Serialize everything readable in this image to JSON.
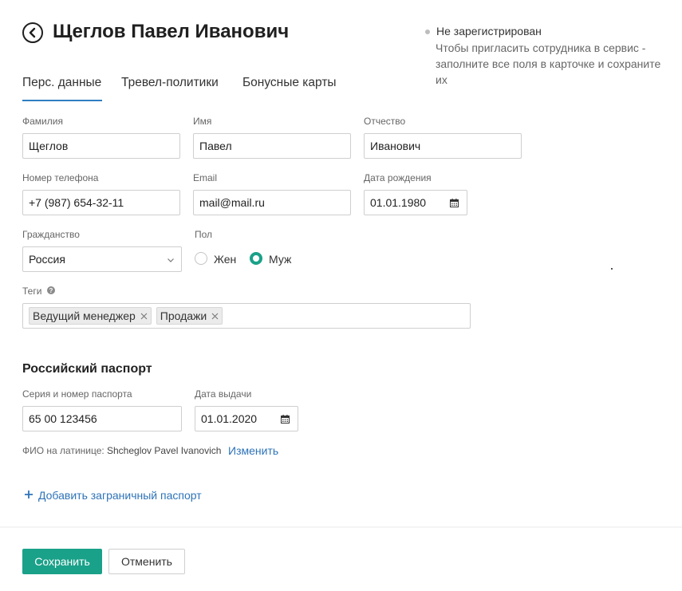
{
  "header": {
    "title": "Щеглов Павел Иванович",
    "status_title": "Не зарегистрирован",
    "status_desc": "Чтобы пригласить сотрудника в сервис - заполните все поля в карточке и сохраните их"
  },
  "tabs": [
    {
      "label": "Перс. данные",
      "active": true
    },
    {
      "label": "Тревел-политики",
      "active": false
    },
    {
      "label": "Бонусные карты",
      "active": false
    }
  ],
  "form": {
    "last_name": {
      "label": "Фамилия",
      "value": "Щеглов"
    },
    "first_name": {
      "label": "Имя",
      "value": "Павел"
    },
    "middle_name": {
      "label": "Отчество",
      "value": "Иванович"
    },
    "phone": {
      "label": "Номер телефона",
      "value": "+7 (987) 654-32-11"
    },
    "email": {
      "label": "Email",
      "value": "mail@mail.ru"
    },
    "birth_date": {
      "label": "Дата рождения",
      "value": "01.01.1980"
    },
    "citizenship": {
      "label": "Гражданство",
      "value": "Россия"
    },
    "gender": {
      "label": "Пол",
      "options": [
        {
          "label": "Жен",
          "checked": false
        },
        {
          "label": "Муж",
          "checked": true
        }
      ]
    },
    "tags": {
      "label": "Теги",
      "help": "?",
      "items": [
        "Ведущий менеджер",
        "Продажи"
      ]
    }
  },
  "passport": {
    "section_title": "Российский паспорт",
    "number": {
      "label": "Серия и номер паспорта",
      "value": "65 00 123456"
    },
    "issue_date": {
      "label": "Дата выдачи",
      "value": "01.01.2020"
    },
    "latin_label": "ФИО на латинице:",
    "latin_value": "Shcheglov Pavel Ivanovich",
    "change_link": "Изменить",
    "add_foreign": "Добавить заграничный паспорт"
  },
  "footer": {
    "save": "Сохранить",
    "cancel": "Отменить"
  },
  "colors": {
    "accent": "#1aa189",
    "link": "#2e73b8",
    "tab_active": "#2e7fc1"
  }
}
